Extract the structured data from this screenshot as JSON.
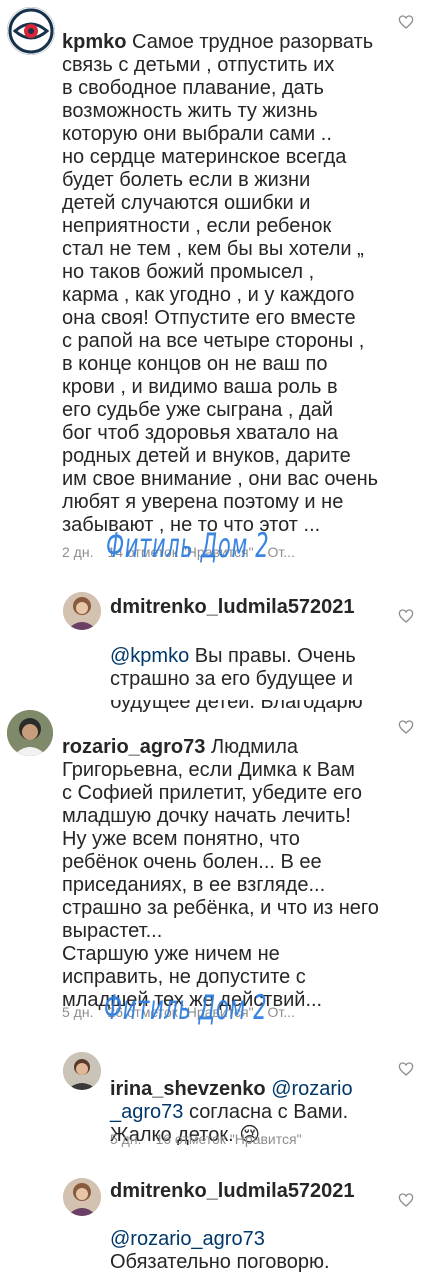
{
  "comments": [
    {
      "username": "kpmko",
      "text": "Самое трудное разорвать\nсвязь с детьми , отпустить их\nв свободное плавание, дать\nвозможность жить ту жизнь\nкоторую они выбрали сами ..\nно сердце материнское всегда\nбудет болеть если в жизни\nдетей случаются ошибки и\nнеприятности , если ребенок\nстал не тем , кем бы вы хотели „\nно таков божий промысел ,\nкарма , как угодно , и у каждого\nона своя! Отпустите его вместе\nс рапой на все четыре стороны ,\nв конце концов он не ваш по\nкрови , и видимо ваша роль в\nего судьбе уже сыграна , дай\nбог чтоб здоровья хватало на\nродных детей и внуков, дарите\nим свое внимание , они вас очень\nлюбят я уверена поэтому и не\nзабывают , не то что этот ...",
      "time": "2 дн.",
      "likes": "14 отметок \"Нравится\"",
      "reply": "От..."
    },
    {
      "username": "dmitrenko_ludmila572021",
      "mention": "@kpmko",
      "text": " Вы правы.  Очень\nстрашно  за его будущее и\nбудущее детей. Благодарю"
    },
    {
      "username": "rozario_agro73",
      "text": "Людмила\nГригорьевна, если Димка к Вам\nс Софией прилетит, убедите его\nмладшую дочку начать лечить!\nНу уже всем понятно, что\nребёнок очень болен... В ее\nприседаниях, в ее взгляде...\nстрашно за ребёнка, и что из него\nвырастет...\nСтаршую уже ничем не\nисправить, не допустите с\nмладшей тех же действий...",
      "time": "5 дн.",
      "likes": "26 отметок \"Нравится\"",
      "reply": "От..."
    },
    {
      "username": "irina_shevzenko",
      "mention": "@rozario\n_agro73",
      "text": " согласна с Вами.\nЖалко деток. 😢",
      "time": "5 дн.",
      "likes": "16 отметок \"Нравится\""
    },
    {
      "username": "dmitrenko_ludmila572021",
      "mention": "@rozario_agro73",
      "text": "Обязательно поговорю."
    }
  ],
  "watermark": "Фитиль Дом 2",
  "colors": {
    "text": "#262626",
    "meta": "#8e8e8e",
    "mention": "#00376b",
    "watermark": "#2f7fe0"
  }
}
